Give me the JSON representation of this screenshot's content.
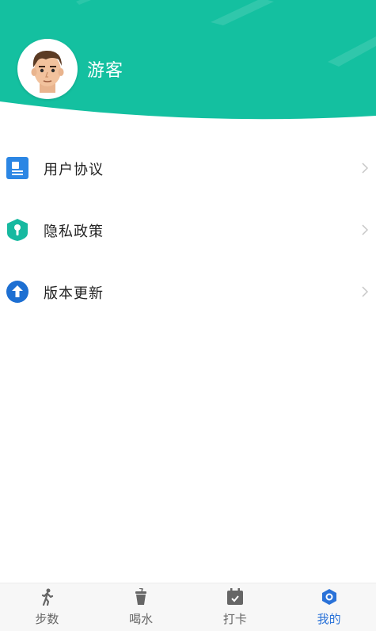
{
  "profile": {
    "username": "游客",
    "header_color": "#14c0a0"
  },
  "menu": {
    "items": [
      {
        "label": "用户协议",
        "icon": "document-icon",
        "color": "#2b86e4"
      },
      {
        "label": "隐私政策",
        "icon": "privacy-shield-icon",
        "color": "#17b9a0"
      },
      {
        "label": "版本更新",
        "icon": "upload-arrow-icon",
        "color": "#1d6fd2"
      }
    ]
  },
  "tabbar": {
    "active_color": "#2a72d8",
    "items": [
      {
        "label": "步数",
        "icon": "walking-icon",
        "active": false
      },
      {
        "label": "喝水",
        "icon": "cup-icon",
        "active": false
      },
      {
        "label": "打卡",
        "icon": "calendar-check-icon",
        "active": false
      },
      {
        "label": "我的",
        "icon": "hexagon-settings-icon",
        "active": true
      }
    ]
  }
}
